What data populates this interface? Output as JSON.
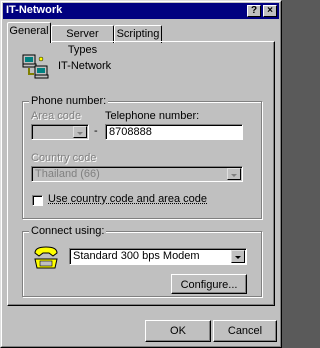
{
  "window": {
    "title": "IT-Network"
  },
  "titlebar_buttons": {
    "help": "?",
    "close": "×"
  },
  "tabs": [
    {
      "label": "General",
      "active": true
    },
    {
      "label": "Server Types",
      "active": false
    },
    {
      "label": "Scripting",
      "active": false
    }
  ],
  "connection": {
    "name": "IT-Network",
    "icon": "computers-network-icon"
  },
  "phone_group": {
    "label": "Phone number:",
    "area_code_label": "Area code",
    "area_code_value": "",
    "separator": "-",
    "telephone_label": "Telephone number:",
    "telephone_value": "8708888",
    "country_code_label": "Country code",
    "country_code_value": "Thailand (66)",
    "use_country_checkbox_label": "Use country code and area code",
    "use_country_checked": false
  },
  "connect_group": {
    "label": "Connect using:",
    "modem_icon": "modem-telephone-icon",
    "modem_value": "Standard  300 bps Modem",
    "configure_label": "Configure..."
  },
  "footer": {
    "ok_label": "OK",
    "cancel_label": "Cancel"
  }
}
